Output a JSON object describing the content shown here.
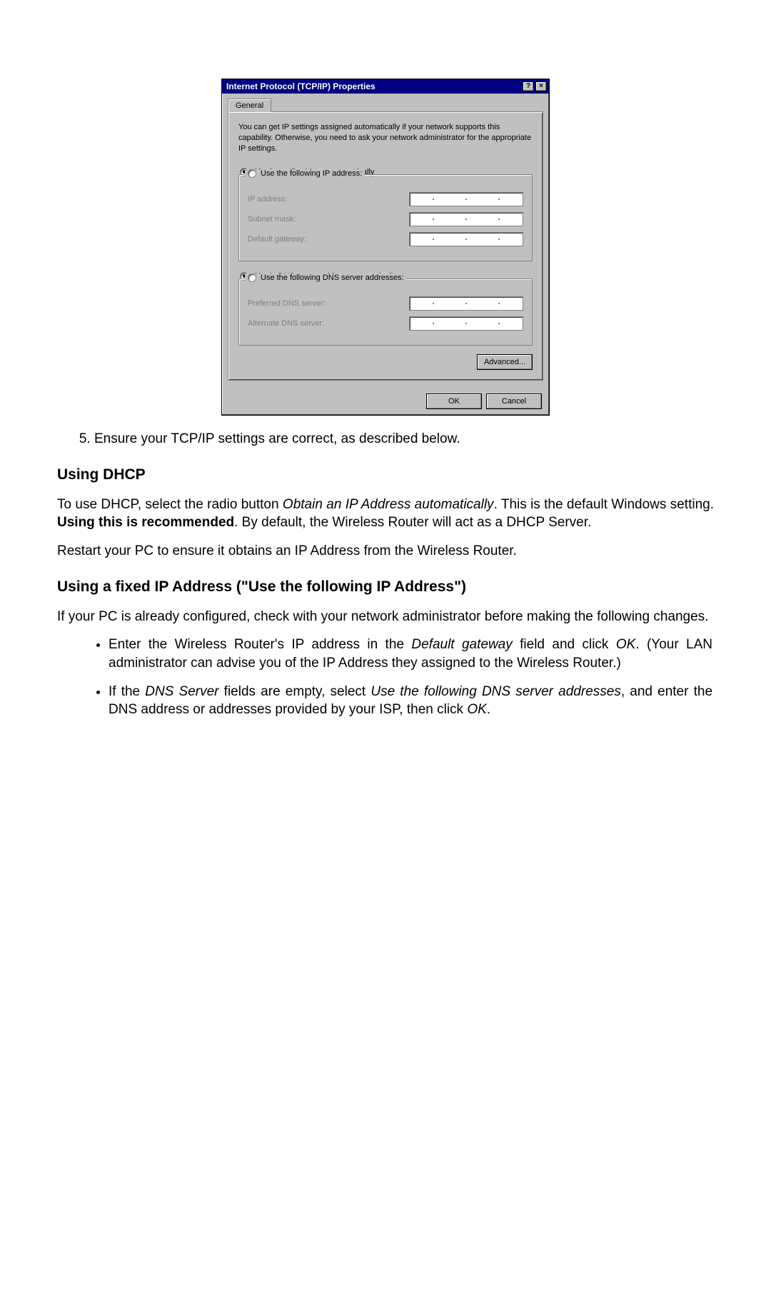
{
  "dialog": {
    "title": "Internet Protocol (TCP/IP) Properties",
    "help_icon": "?",
    "close_icon": "×",
    "tab_general": "General",
    "info_text": "You can get IP settings assigned automatically if your network supports this capability. Otherwise, you need to ask your network administrator for the appropriate IP settings.",
    "radio_auto_ip": "Obtain an IP address automatically",
    "radio_manual_ip": "Use the following IP address:",
    "label_ip": "IP address:",
    "label_subnet": "Subnet mask:",
    "label_gateway": "Default gateway:",
    "radio_auto_dns": "Obtain DNS server address automatically",
    "radio_manual_dns": "Use the following DNS server addresses:",
    "label_pref_dns": "Preferred DNS server:",
    "label_alt_dns": "Alternate DNS server:",
    "btn_advanced": "Advanced...",
    "btn_ok": "OK",
    "btn_cancel": "Cancel"
  },
  "doc": {
    "step5": "Ensure your TCP/IP settings are correct, as described below.",
    "h_dhcp": "Using DHCP",
    "dhcp_p1a": "To use DHCP, select the radio button ",
    "dhcp_p1_obtain": "Obtain an IP Address automatically",
    "dhcp_p1b": ". This is the default Windows setting. ",
    "dhcp_p1_bold": "Using this is recommended",
    "dhcp_p1c": ". By default, the Wireless Router will act as a DHCP Server.",
    "dhcp_p2": "Restart your PC to ensure it obtains an IP Address from the Wireless Router.",
    "h_fixed": "Using a fixed IP Address (\"Use the following IP Address\")",
    "fixed_p1": "If your PC is already configured, check with your network administrator before making the following changes.",
    "bullet1a": "Enter the Wireless Router's IP address in the ",
    "bullet1_def": "Default gateway",
    "bullet1b": " field and click ",
    "bullet1_ok": "OK",
    "bullet1c": ". (Your LAN administrator can advise you of the IP Address they assigned to the Wireless Router.)",
    "bullet2a": "If the ",
    "bullet2_dns": "DNS Server",
    "bullet2b": " fields are empty, select ",
    "bullet2_use": "Use the following DNS server addresses",
    "bullet2c": ", and enter the DNS address or addresses provided by your ISP, then click ",
    "bullet2_ok": "OK",
    "bullet2d": "."
  }
}
